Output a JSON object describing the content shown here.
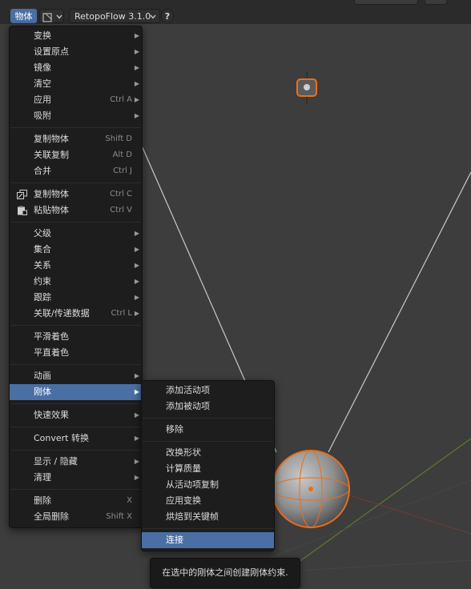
{
  "header": {
    "object_menu": "物体",
    "addon_label": "RetopoFlow 3.1.0",
    "help_icon": "question-circle-icon"
  },
  "object_menu": {
    "items": [
      {
        "label": "变换",
        "submenu": true
      },
      {
        "label": "设置原点",
        "submenu": true
      },
      {
        "label": "镜像",
        "submenu": true
      },
      {
        "label": "清空",
        "submenu": true
      },
      {
        "label": "应用",
        "shortcut": "Ctrl A",
        "submenu": true
      },
      {
        "label": "吸附",
        "submenu": true
      },
      {
        "label": "复制物体",
        "shortcut": "Shift D"
      },
      {
        "label": "关联复制",
        "shortcut": "Alt D"
      },
      {
        "label": "合并",
        "shortcut": "Ctrl J"
      },
      {
        "label": "复制物体",
        "shortcut": "Ctrl C",
        "icon": "copy-icon"
      },
      {
        "label": "粘贴物体",
        "shortcut": "Ctrl V",
        "icon": "paste-icon"
      },
      {
        "label": "父级",
        "submenu": true
      },
      {
        "label": "集合",
        "submenu": true
      },
      {
        "label": "关系",
        "submenu": true
      },
      {
        "label": "约束",
        "submenu": true
      },
      {
        "label": "跟踪",
        "submenu": true
      },
      {
        "label": "关联/传递数据",
        "shortcut": "Ctrl L",
        "submenu": true
      },
      {
        "label": "平滑着色"
      },
      {
        "label": "平直着色"
      },
      {
        "label": "动画",
        "submenu": true
      },
      {
        "label": "刚体",
        "submenu": true,
        "active": true
      },
      {
        "label": "快速效果",
        "submenu": true
      },
      {
        "label": "Convert 转换",
        "submenu": true
      },
      {
        "label": "显示 / 隐藏",
        "submenu": true
      },
      {
        "label": "清理",
        "submenu": true
      },
      {
        "label": "删除",
        "shortcut": "X"
      },
      {
        "label": "全局删除",
        "shortcut": "Shift X"
      }
    ]
  },
  "rigid_body_menu": {
    "items": [
      {
        "label": "添加活动项"
      },
      {
        "label": "添加被动项"
      },
      {
        "label": "移除"
      },
      {
        "label": "改换形状"
      },
      {
        "label": "计算质量"
      },
      {
        "label": "从活动项复制"
      },
      {
        "label": "应用变换"
      },
      {
        "label": "烘焙到关键帧"
      },
      {
        "label": "连接",
        "active": true
      }
    ]
  },
  "tooltip": {
    "text": "在选中的刚体之间创建刚体约束."
  },
  "colors": {
    "highlight": "#4a6fa5",
    "menu_bg": "#1d1d1d",
    "viewport_bg": "#3d3d3d",
    "selection_outline": "#e8701a"
  }
}
